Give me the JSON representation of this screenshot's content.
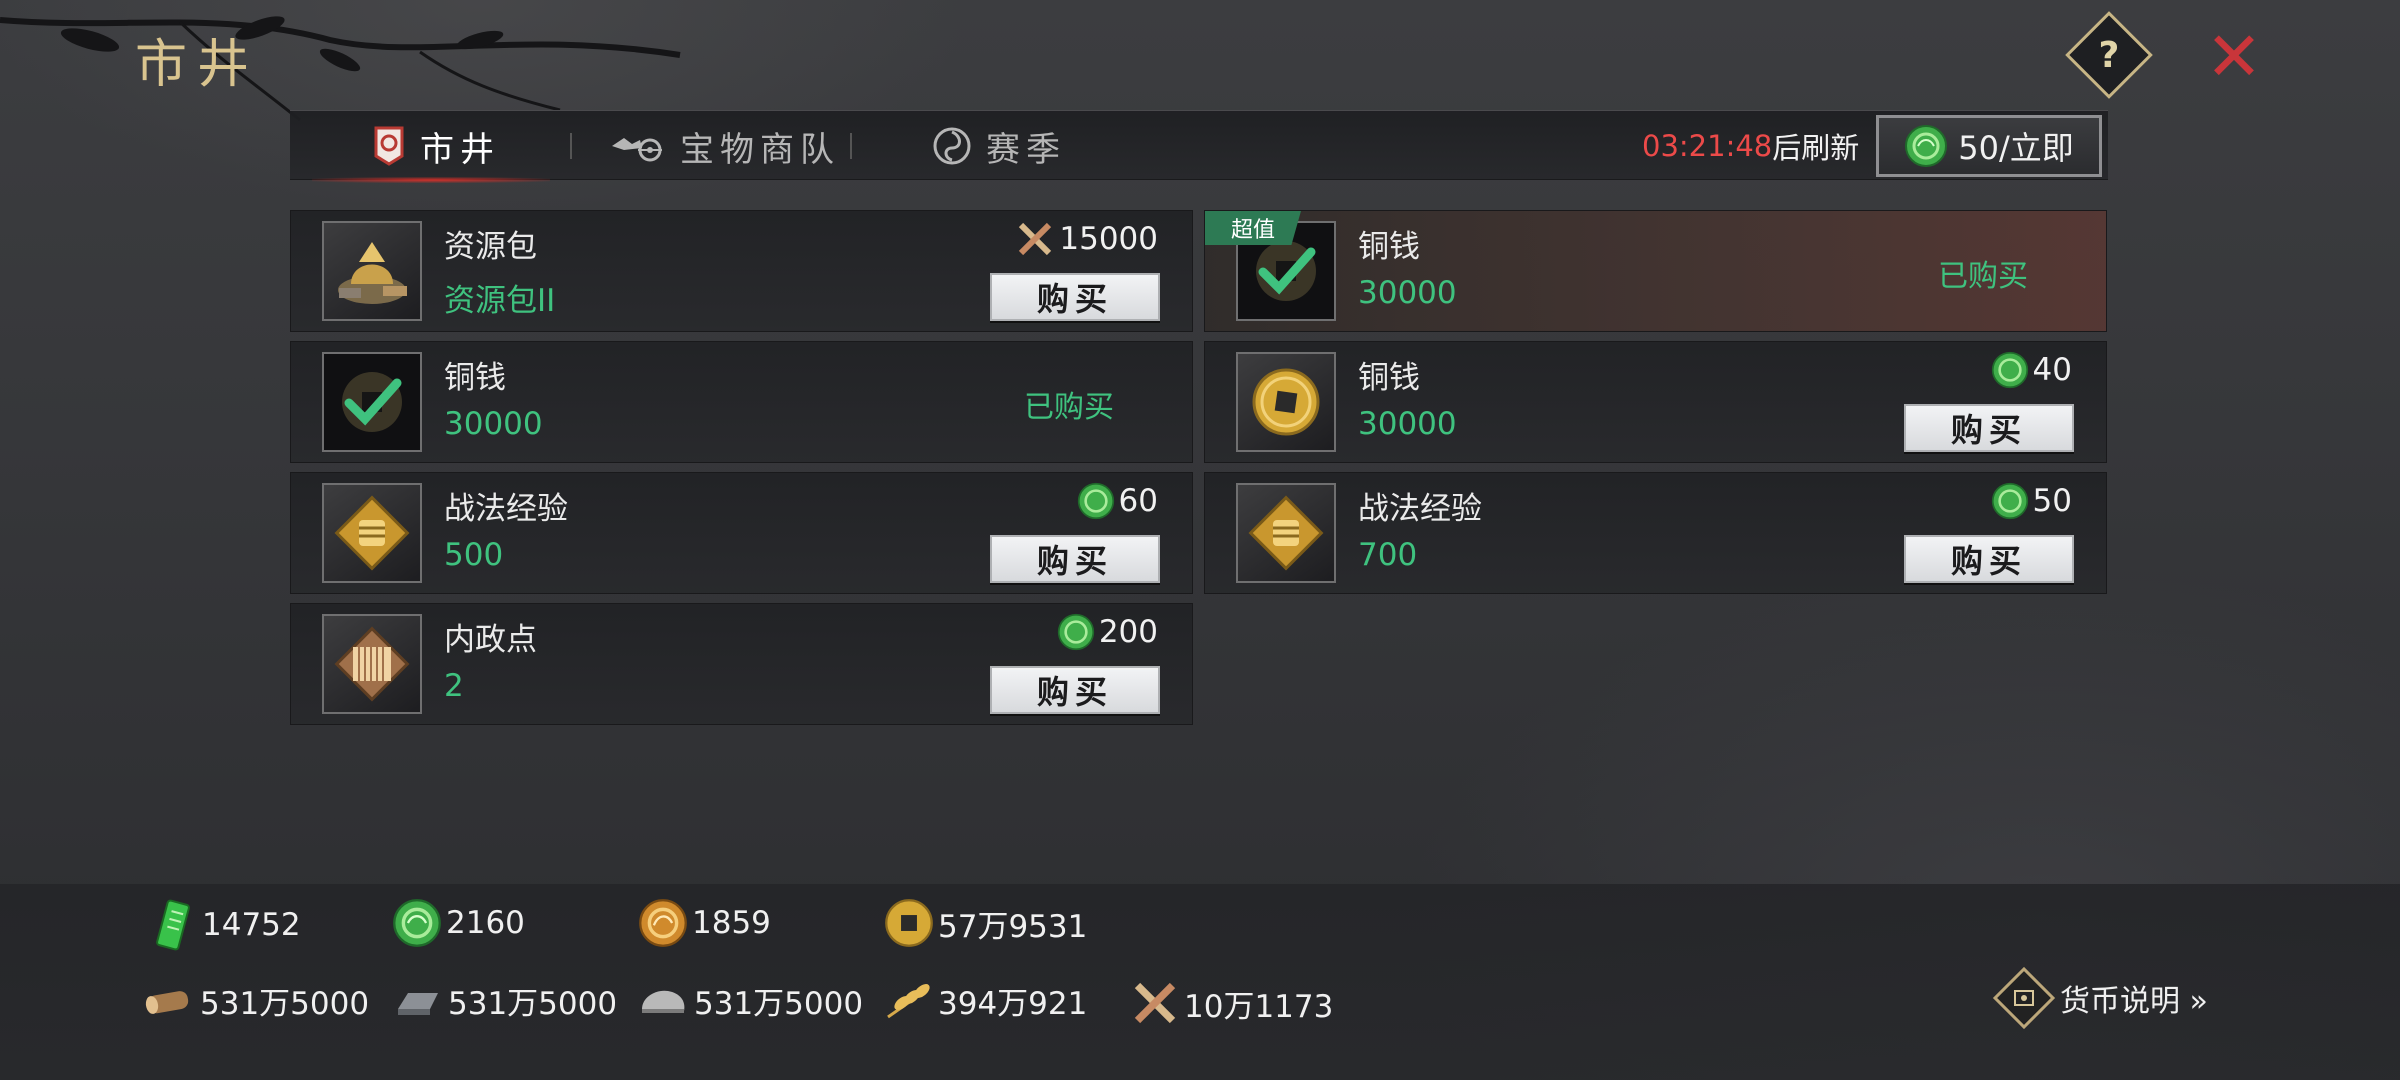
{
  "header": {
    "title": "市井",
    "help_label": "?",
    "close_label": "✕"
  },
  "tabs": [
    {
      "label": "市井",
      "icon": "market-seal-icon",
      "active": true
    },
    {
      "label": "宝物商队",
      "icon": "caravan-icon",
      "active": false
    },
    {
      "label": "赛季",
      "icon": "season-swirl-icon",
      "active": false
    }
  ],
  "refresh": {
    "time": "03:21:48",
    "suffix": "后刷新",
    "button_label": "50/立即",
    "button_icon": "jade-coin-icon"
  },
  "items": [
    {
      "name": "资源包",
      "sub": "资源包II",
      "price": "15000",
      "price_icon": "crossed-swords-icon",
      "state": "buy",
      "buy_label": "购买",
      "icon": "resource-pack-icon"
    },
    {
      "name": "铜钱",
      "sub": "30000",
      "badge": "超值",
      "state": "bought",
      "bought_label": "已购买",
      "icon": "copper-coin-checked-icon"
    },
    {
      "name": "铜钱",
      "sub": "30000",
      "state": "bought",
      "bought_label": "已购买",
      "icon": "copper-coin-checked-icon"
    },
    {
      "name": "铜钱",
      "sub": "30000",
      "price": "40",
      "price_icon": "jade-coin-icon",
      "state": "buy",
      "buy_label": "购买",
      "icon": "copper-coin-icon"
    },
    {
      "name": "战法经验",
      "sub": "500",
      "price": "60",
      "price_icon": "jade-coin-icon",
      "state": "buy",
      "buy_label": "购买",
      "icon": "fist-emblem-icon"
    },
    {
      "name": "战法经验",
      "sub": "700",
      "price": "50",
      "price_icon": "jade-coin-icon",
      "state": "buy",
      "buy_label": "购买",
      "icon": "fist-emblem-icon"
    },
    {
      "name": "内政点",
      "sub": "2",
      "price": "200",
      "price_icon": "jade-coin-icon",
      "state": "buy",
      "buy_label": "购买",
      "icon": "bamboo-scroll-icon"
    }
  ],
  "currencies": {
    "row1": [
      {
        "icon": "jade-tablet-icon",
        "value": "14752"
      },
      {
        "icon": "jade-coin-icon",
        "value": "2160"
      },
      {
        "icon": "gold-dragon-coin-icon",
        "value": "1859"
      },
      {
        "icon": "copper-coin-icon",
        "value": "57万9531"
      }
    ],
    "row2": [
      {
        "icon": "wood-log-icon",
        "value": "531万5000"
      },
      {
        "icon": "iron-ingot-icon",
        "value": "531万5000"
      },
      {
        "icon": "stone-icon",
        "value": "531万5000"
      },
      {
        "icon": "grain-icon",
        "value": "394万921"
      },
      {
        "icon": "crossed-swords-icon",
        "value": "10万1173"
      }
    ]
  },
  "currency_help": {
    "label": "货币说明 »",
    "icon": "info-diamond-icon"
  },
  "colors": {
    "accent_green": "#3fc27f",
    "timer_red": "#ec4a49",
    "title_gold": "#d9c48f",
    "close_red": "#c9353a"
  }
}
